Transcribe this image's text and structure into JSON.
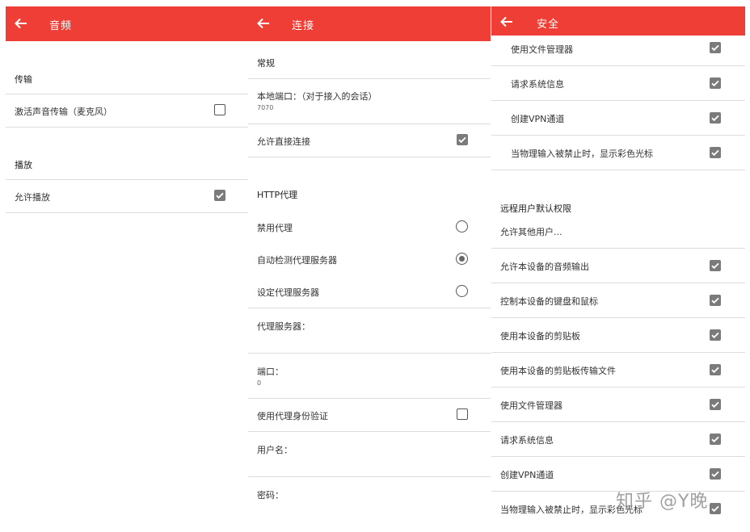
{
  "audio": {
    "title": "音频",
    "section_transfer": "传输",
    "activate_audio_label": "激活声音传输（麦克风）",
    "section_playback": "播放",
    "allow_playback_label": "允许播放"
  },
  "connection": {
    "title": "连接",
    "section_general": "常规",
    "local_port_label": "本地端口：（对于接入的会话）",
    "local_port_value": "7070",
    "allow_direct_label": "允许直接连接",
    "section_http_proxy": "HTTP代理",
    "disable_proxy_label": "禁用代理",
    "auto_detect_label": "自动检测代理服务器",
    "set_proxy_label": "设定代理服务器",
    "proxy_server_label": "代理服务器：",
    "port_label": "端口：",
    "port_value": "0",
    "use_proxy_auth_label": "使用代理身份验证",
    "username_label": "用户名：",
    "password_label": "密码："
  },
  "security": {
    "title": "安全",
    "top_items": [
      "使用文件管理器",
      "请求系统信息",
      "创建VPN通道",
      "当物理输入被禁止时，显示彩色光标"
    ],
    "section_remote_defaults": "远程用户默认权限",
    "allow_other_users": "允许其他用户...",
    "items": [
      "允许本设备的音频输出",
      "控制本设备的键盘和鼠标",
      "使用本设备的剪贴板",
      "使用本设备的剪贴板传输文件",
      "使用文件管理器",
      "请求系统信息",
      "创建VPN通道",
      "当物理输入被禁止时，显示彩色光标"
    ]
  },
  "watermark": "知乎 @Y晚",
  "colors": {
    "appbar": "#ef3e36",
    "checkbox_checked": "#7b7b7b",
    "divider": "#dcdcdc"
  },
  "icons": {
    "back": "arrow-left-icon",
    "checked": "checkbox-checked-icon",
    "unchecked": "checkbox-unchecked-icon",
    "radio": "radio-icon"
  }
}
